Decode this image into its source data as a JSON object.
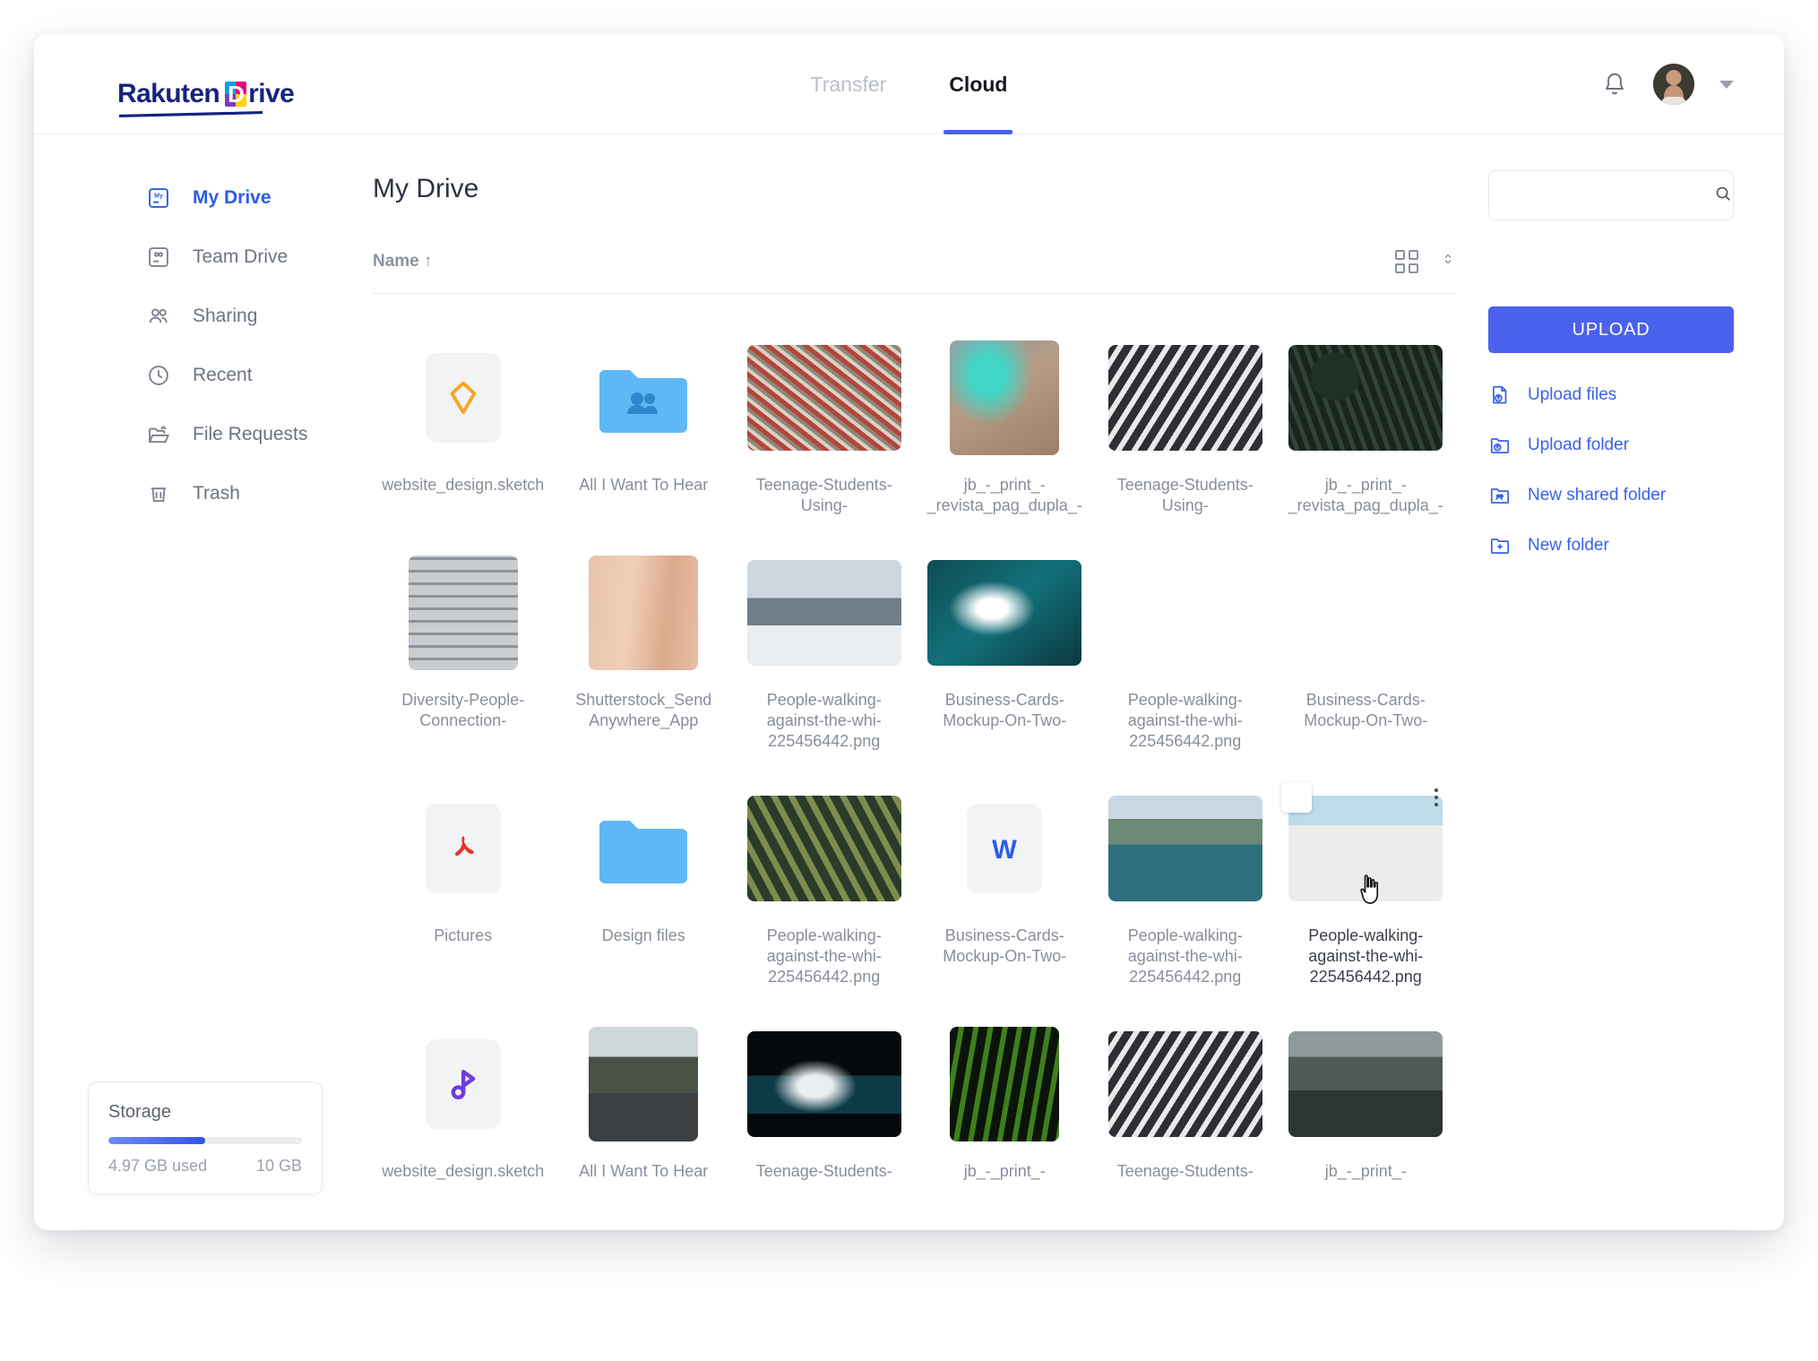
{
  "brand": {
    "name_primary": "Rakuten",
    "name_d": "D",
    "name_secondary": "rive"
  },
  "nav": {
    "tabs": [
      {
        "label": "Transfer",
        "active": false
      },
      {
        "label": "Cloud",
        "active": true
      }
    ],
    "bell_icon": "bell-icon",
    "avatar_icon": "avatar",
    "caret_icon": "chevron-down-icon"
  },
  "sidebar": {
    "items": [
      {
        "label": "My Drive",
        "icon": "my-drive-icon",
        "active": true
      },
      {
        "label": "Team Drive",
        "icon": "team-drive-icon",
        "active": false
      },
      {
        "label": "Sharing",
        "icon": "sharing-icon",
        "active": false
      },
      {
        "label": "Recent",
        "icon": "clock-icon",
        "active": false
      },
      {
        "label": "File Requests",
        "icon": "file-request-icon",
        "active": false
      },
      {
        "label": "Trash",
        "icon": "trash-icon",
        "active": false
      }
    ],
    "storage": {
      "title": "Storage",
      "used_label": "4.97 GB used",
      "total_label": "10 GB",
      "used_percent": 50
    }
  },
  "main": {
    "page_title": "My Drive",
    "sort_column": "Name ↑",
    "view_icon": "grid-view-icon",
    "sort_toggle_icon": "sort-updown-icon",
    "files": [
      {
        "name": "website_design.sketch",
        "kind": "sketch"
      },
      {
        "name": "All I Want To Hear",
        "kind": "shared-folder"
      },
      {
        "name": "Teenage-Students-Using-",
        "kind": "image",
        "thumb": "aerial-city-plaza"
      },
      {
        "name": "jb_-_print_-_revista_pag_dupla_-",
        "kind": "image-tall",
        "thumb": "teal-delta"
      },
      {
        "name": "Teenage-Students-Using-",
        "kind": "image",
        "thumb": "orange-kayak-rocks"
      },
      {
        "name": "jb_-_print_-_revista_pag_dupla_-",
        "kind": "image",
        "thumb": "dark-forest-aerial"
      },
      {
        "name": "Diversity-People-Connection-",
        "kind": "image-tall",
        "thumb": "grey-building-grid"
      },
      {
        "name": "Shutterstock_Send Anywhere_App",
        "kind": "image-tall",
        "thumb": "peach-skin"
      },
      {
        "name": "People-walking-against-the-whi-225456442.png",
        "kind": "image",
        "thumb": "snow-mountains"
      },
      {
        "name": "Business-Cards-Mockup-On-Two-",
        "kind": "image",
        "thumb": "ocean-wave"
      },
      {
        "name": "People-walking-against-the-whi-225456442.png",
        "kind": "image-sq",
        "thumb": "red-nebula"
      },
      {
        "name": "Business-Cards-Mockup-On-Two-",
        "kind": "image",
        "thumb": "blue-nebula"
      },
      {
        "name": "Pictures",
        "kind": "pdf"
      },
      {
        "name": "Design files",
        "kind": "folder"
      },
      {
        "name": "People-walking-against-the-whi-225456442.png",
        "kind": "image",
        "thumb": "river-delta-green"
      },
      {
        "name": "Business-Cards-Mockup-On-Two-",
        "kind": "word"
      },
      {
        "name": "People-walking-against-the-whi-225456442.png",
        "kind": "image",
        "thumb": "lake-canoe"
      },
      {
        "name": "People-walking-against-the-whi-225456442.png",
        "kind": "image",
        "thumb": "white-amphitheatre",
        "hovered": true
      },
      {
        "name": "website_design.sketch",
        "kind": "music"
      },
      {
        "name": "All I Want To Hear",
        "kind": "image-tall",
        "thumb": "mountain-road"
      },
      {
        "name": "Teenage-Students-",
        "kind": "image",
        "thumb": "dark-pool-wave"
      },
      {
        "name": "jb_-_print_-",
        "kind": "image-tall",
        "thumb": "green-leaf-dark"
      },
      {
        "name": "Teenage-Students-",
        "kind": "image",
        "thumb": "orange-kayak-rocks"
      },
      {
        "name": "jb_-_print_-",
        "kind": "image",
        "thumb": "foggy-forest"
      }
    ]
  },
  "rail": {
    "search_placeholder": "",
    "search_value": "",
    "search_icon": "search-icon",
    "upload_button": "UPLOAD",
    "links": [
      {
        "label": "Upload files",
        "icon": "upload-file-icon"
      },
      {
        "label": "Upload folder",
        "icon": "upload-folder-icon"
      },
      {
        "label": "New shared folder",
        "icon": "new-shared-folder-icon"
      },
      {
        "label": "New folder",
        "icon": "new-folder-icon"
      }
    ]
  },
  "colors": {
    "accent": "#4a62eb",
    "active_nav": "#2b5ce6",
    "link": "#3a62e8",
    "muted_text": "#888e99",
    "folder_blue": "#5fb8f5",
    "sketch_orange": "#f5a623",
    "pdf_red": "#e8342a",
    "word_blue": "#2b5ce6",
    "music_purple": "#6c3ce0"
  }
}
